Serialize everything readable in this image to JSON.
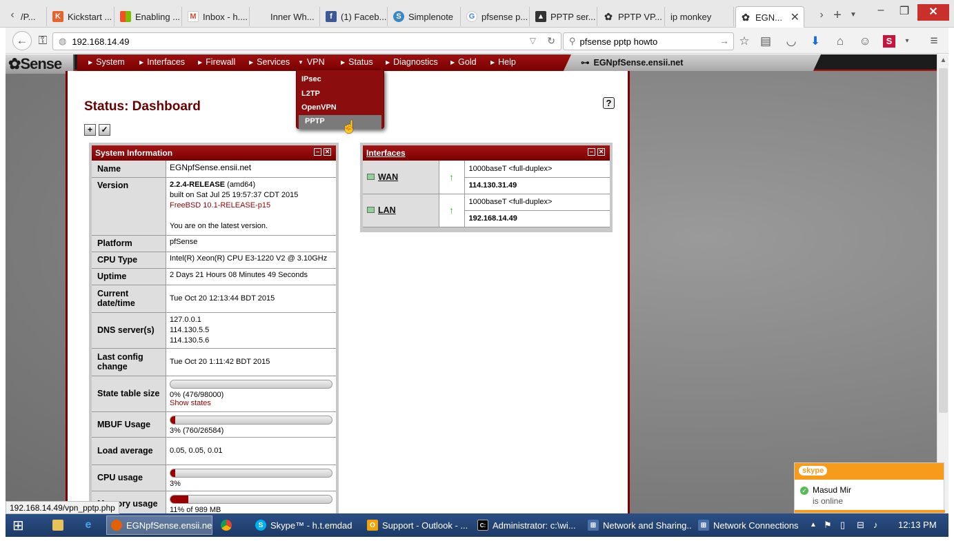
{
  "browser": {
    "tabs": [
      {
        "label": "/P...",
        "icon": "generic-page-icon",
        "color": "#888888"
      },
      {
        "label": "Kickstart ...",
        "icon": "kickstarter-icon",
        "color": "#e8622c"
      },
      {
        "label": "Enabling ...",
        "icon": "windows-logo-icon",
        "color": "#2f8fd8"
      },
      {
        "label": "Inbox - h....",
        "icon": "gmail-icon",
        "color": "#d64937"
      },
      {
        "label": "Inner Wh...",
        "icon": "blank-page-icon",
        "color": "#dddddd"
      },
      {
        "label": "(1) Faceb...",
        "icon": "facebook-icon",
        "color": "#3b5998"
      },
      {
        "label": "Simplenote",
        "icon": "simplenote-icon",
        "color": "#3a87c8"
      },
      {
        "label": "pfsense p...",
        "icon": "google-icon",
        "color": "#4285f4"
      },
      {
        "label": "PPTP ser...",
        "icon": "server-icon",
        "color": "#333333"
      },
      {
        "label": "PPTP VP...",
        "icon": "pfsense-tab-icon",
        "color": "#444444"
      },
      {
        "label": "ip monkey",
        "icon": "blank-page-icon",
        "color": "#dddddd"
      },
      {
        "label": "EGN...",
        "icon": "pfsense-tab-icon",
        "color": "#444444"
      }
    ],
    "url": "192.168.14.49",
    "search_value": "pfsense pptp howto",
    "status_url": "192.168.14.49/vpn_pptp.php"
  },
  "pfsense": {
    "logo": "Sense",
    "menu": [
      "System",
      "Interfaces",
      "Firewall",
      "Services",
      "VPN",
      "Status",
      "Diagnostics",
      "Gold",
      "Help"
    ],
    "hostname": "EGNpfSense.ensii.net",
    "vpn_menu": [
      "IPsec",
      "L2TP",
      "OpenVPN",
      "PPTP"
    ],
    "page_title": "Status: Dashboard"
  },
  "system_info": {
    "title": "System Information",
    "rows": {
      "name": {
        "label": "Name",
        "value": "EGNpfSense.ensii.net"
      },
      "version": {
        "label": "Version",
        "release": "2.2.4-RELEASE",
        "arch": " (amd64)",
        "built": "built on Sat Jul 25 19:57:37 CDT 2015",
        "freebsd": "FreeBSD 10.1-RELEASE-p15",
        "latest": "You are on the latest version."
      },
      "platform": {
        "label": "Platform",
        "value": "pfSense"
      },
      "cpu_type": {
        "label": "CPU Type",
        "value": "Intel(R) Xeon(R) CPU E3-1220 V2 @ 3.10GHz"
      },
      "uptime": {
        "label": "Uptime",
        "value": "2 Days 21 Hours 08 Minutes 49 Seconds"
      },
      "datetime": {
        "label": "Current date/time",
        "value": "Tue Oct 20 12:13:44 BDT 2015"
      },
      "dns": {
        "label": "DNS server(s)",
        "servers": [
          "127.0.0.1",
          "114.130.5.5",
          "114.130.5.6"
        ]
      },
      "last_config": {
        "label": "Last config change",
        "value": "Tue Oct 20 1:11:42 BDT 2015"
      },
      "state_table": {
        "label": "State table size",
        "value": "0% (476/98000)",
        "percent": 0,
        "link": "Show states"
      },
      "mbuf": {
        "label": "MBUF Usage",
        "value": "3% (760/26584)",
        "percent": 3
      },
      "load": {
        "label": "Load average",
        "value": "0.05, 0.05, 0.01"
      },
      "cpu_usage": {
        "label": "CPU usage",
        "value": "3%",
        "percent": 3
      },
      "memory": {
        "label": "Memory usage",
        "value": "11% of 989 MB",
        "percent": 11
      }
    }
  },
  "interfaces": {
    "title": "Interfaces",
    "items": [
      {
        "name": "WAN",
        "media": "1000baseT <full-duplex>",
        "ip": "114.130.31.49",
        "status": "up"
      },
      {
        "name": "LAN",
        "media": "1000baseT <full-duplex>",
        "ip": "192.168.14.49",
        "status": "up"
      }
    ]
  },
  "skype": {
    "brand": "skype",
    "contact": "Masud Mir",
    "status": "is online"
  },
  "taskbar": {
    "items": [
      {
        "label": "EGNpfSense.ensii.net...",
        "icon": "firefox-icon"
      },
      {
        "label": "",
        "icon": "chrome-icon"
      },
      {
        "label": "Skype™ - h.t.emdad",
        "icon": "skype-icon"
      },
      {
        "label": "Support - Outlook - ...",
        "icon": "outlook-icon"
      },
      {
        "label": "Administrator: c:\\wi...",
        "icon": "cmd-icon"
      },
      {
        "label": "Network and Sharing...",
        "icon": "network-sharing-icon"
      },
      {
        "label": "Network Connections",
        "icon": "network-connections-icon"
      }
    ],
    "clock": "12:13 PM"
  },
  "colors": {
    "pfsense_red": "#990000",
    "skype_orange": "#f79b1b",
    "taskbar": "#1d3a66"
  }
}
